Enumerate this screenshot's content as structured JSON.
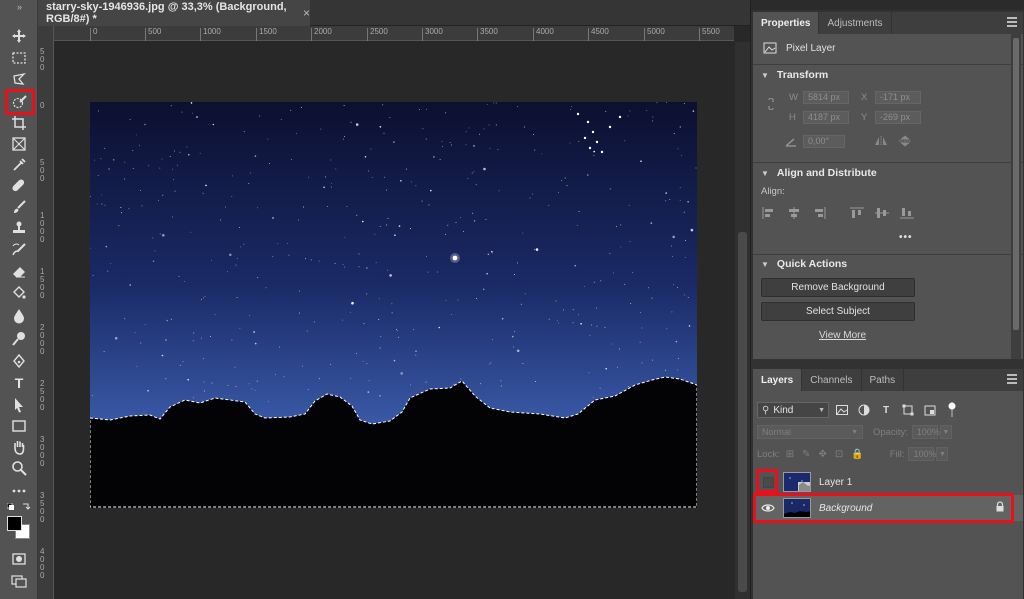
{
  "document": {
    "tab_title": "starry-sky-1946936.jpg @ 33,3% (Background, RGB/8#) *",
    "close_glyph": "×"
  },
  "toolbar": {
    "collapse_glyph": "»",
    "text_tool_label": "T",
    "tools": [
      "move-tool",
      "marquee-tool",
      "lasso-tool",
      "quick-selection-tool",
      "crop-tool",
      "frame-tool",
      "eyedropper-tool",
      "healing-brush-tool",
      "brush-tool",
      "clone-stamp-tool",
      "history-brush-tool",
      "eraser-tool",
      "paint-bucket-tool",
      "blur-tool",
      "dodge-tool",
      "pen-tool",
      "type-tool",
      "path-selection-tool",
      "rectangle-tool",
      "hand-tool",
      "zoom-tool",
      "more-tools",
      "color-swatches",
      "quick-mask",
      "screen-mode"
    ]
  },
  "ruler": {
    "horizontal": [
      "0",
      "500",
      "1000",
      "1500",
      "2000",
      "2500",
      "3000",
      "3500",
      "4000",
      "4500",
      "5000",
      "5500"
    ],
    "vertical": [
      "5\n0\n0",
      "0",
      "5\n0\n0",
      "1\n0\n0\n0",
      "1\n5\n0\n0",
      "2\n0\n0\n0",
      "2\n5\n0\n0",
      "3\n0\n0\n0",
      "3\n5\n0\n0",
      "4\n0\n0\n0"
    ]
  },
  "properties": {
    "tabs": [
      "Properties",
      "Adjustments"
    ],
    "layer_type": "Pixel Layer",
    "transform": {
      "title": "Transform",
      "w_label": "W",
      "w_value": "5814 px",
      "h_label": "H",
      "h_value": "4187 px",
      "x_label": "X",
      "x_value": "-171 px",
      "y_label": "Y",
      "y_value": "-269 px",
      "angle_value": "0,00°"
    },
    "align": {
      "title": "Align and Distribute",
      "label": "Align:",
      "more": "•••"
    },
    "quick_actions": {
      "title": "Quick Actions",
      "remove_bg": "Remove Background",
      "select_subject": "Select Subject",
      "view_more": "View More"
    }
  },
  "layers": {
    "tabs": [
      "Layers",
      "Channels",
      "Paths"
    ],
    "kind_label": "Kind",
    "blend_mode": "Normal",
    "opacity_label": "Opacity:",
    "opacity_value": "100%",
    "lock_label": "Lock:",
    "fill_label": "Fill:",
    "fill_value": "100%",
    "items": [
      {
        "name": "Layer 1",
        "visible": false
      },
      {
        "name": "Background",
        "visible": true,
        "locked": true
      }
    ]
  },
  "colors": {
    "highlight": "#e8101a",
    "panel": "#535353",
    "canvas": "#282828"
  }
}
